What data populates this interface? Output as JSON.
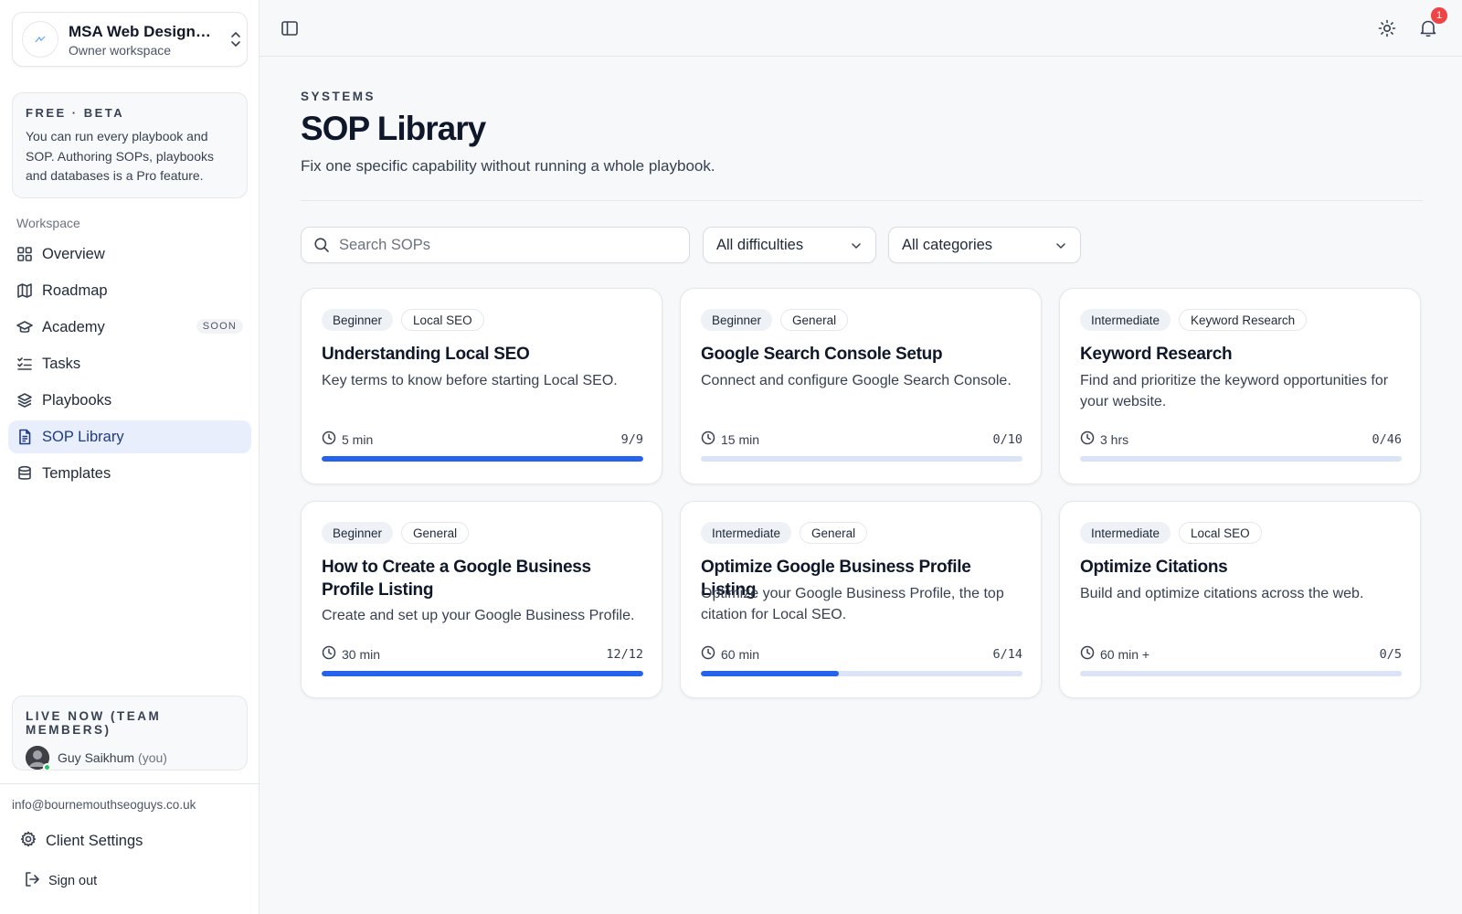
{
  "workspace": {
    "name": "MSA Web Design Bournemouth",
    "subtitle": "Owner workspace"
  },
  "beta": {
    "title": "FREE · BETA",
    "text": "You can run every playbook and SOP. Authoring SOPs, playbooks and databases is a Pro feature."
  },
  "nav": {
    "section_label": "Workspace",
    "items": [
      {
        "label": "Overview",
        "icon": "grid-icon"
      },
      {
        "label": "Roadmap",
        "icon": "map-icon"
      },
      {
        "label": "Academy",
        "icon": "graduation-cap-icon",
        "badge": "SOON"
      },
      {
        "label": "Tasks",
        "icon": "list-checks-icon"
      },
      {
        "label": "Playbooks",
        "icon": "layers-icon"
      },
      {
        "label": "SOP Library",
        "icon": "file-text-icon",
        "active": true
      },
      {
        "label": "Templates",
        "icon": "database-icon"
      }
    ]
  },
  "live": {
    "title": "LIVE NOW (TEAM MEMBERS)",
    "user_name": "Guy Saikhum",
    "user_suffix": "(you)"
  },
  "footer": {
    "email": "info@bournemouthseoguys.co.uk",
    "settings_label": "Client Settings",
    "signout_label": "Sign out"
  },
  "topbar": {
    "notification_count": "1"
  },
  "page": {
    "eyebrow": "SYSTEMS",
    "title": "SOP Library",
    "subtitle": "Fix one specific capability without running a whole playbook."
  },
  "filters": {
    "search_placeholder": "Search SOPs",
    "difficulty": "All difficulties",
    "category": "All categories"
  },
  "colors": {
    "accent": "#2563eb",
    "track": "#dbe4f7",
    "active_nav_bg": "#e8eefb",
    "badge": "#ef4444"
  },
  "cards": [
    {
      "level": "Beginner",
      "category": "Local SEO",
      "title": "Understanding Local SEO",
      "description": "Key terms to know before starting Local SEO.",
      "duration": "5 min",
      "progress": "9/9",
      "done": 9,
      "total": 9
    },
    {
      "level": "Beginner",
      "category": "General",
      "title": "Google Search Console Setup",
      "description": "Connect and configure Google Search Console.",
      "duration": "15 min",
      "progress": "0/10",
      "done": 0,
      "total": 10
    },
    {
      "level": "Intermediate",
      "category": "Keyword Research",
      "title": "Keyword Research",
      "description": "Find and prioritize the keyword opportunities for your website.",
      "duration": "3 hrs",
      "progress": "0/46",
      "done": 0,
      "total": 46
    },
    {
      "level": "Beginner",
      "category": "General",
      "title": "How to Create a Google Business Profile Listing",
      "description": "Create and set up your Google Business Profile.",
      "duration": "30 min",
      "progress": "12/12",
      "done": 12,
      "total": 12
    },
    {
      "level": "Intermediate",
      "category": "General",
      "title": "Optimize Google Business Profile Listing",
      "description": "Optimize your Google Business Profile, the top citation for Local SEO.",
      "duration": "60 min",
      "progress": "6/14",
      "done": 6,
      "total": 14
    },
    {
      "level": "Intermediate",
      "category": "Local SEO",
      "title": "Optimize Citations",
      "description": "Build and optimize citations across the web.",
      "duration": "60 min +",
      "progress": "0/5",
      "done": 0,
      "total": 5
    }
  ]
}
